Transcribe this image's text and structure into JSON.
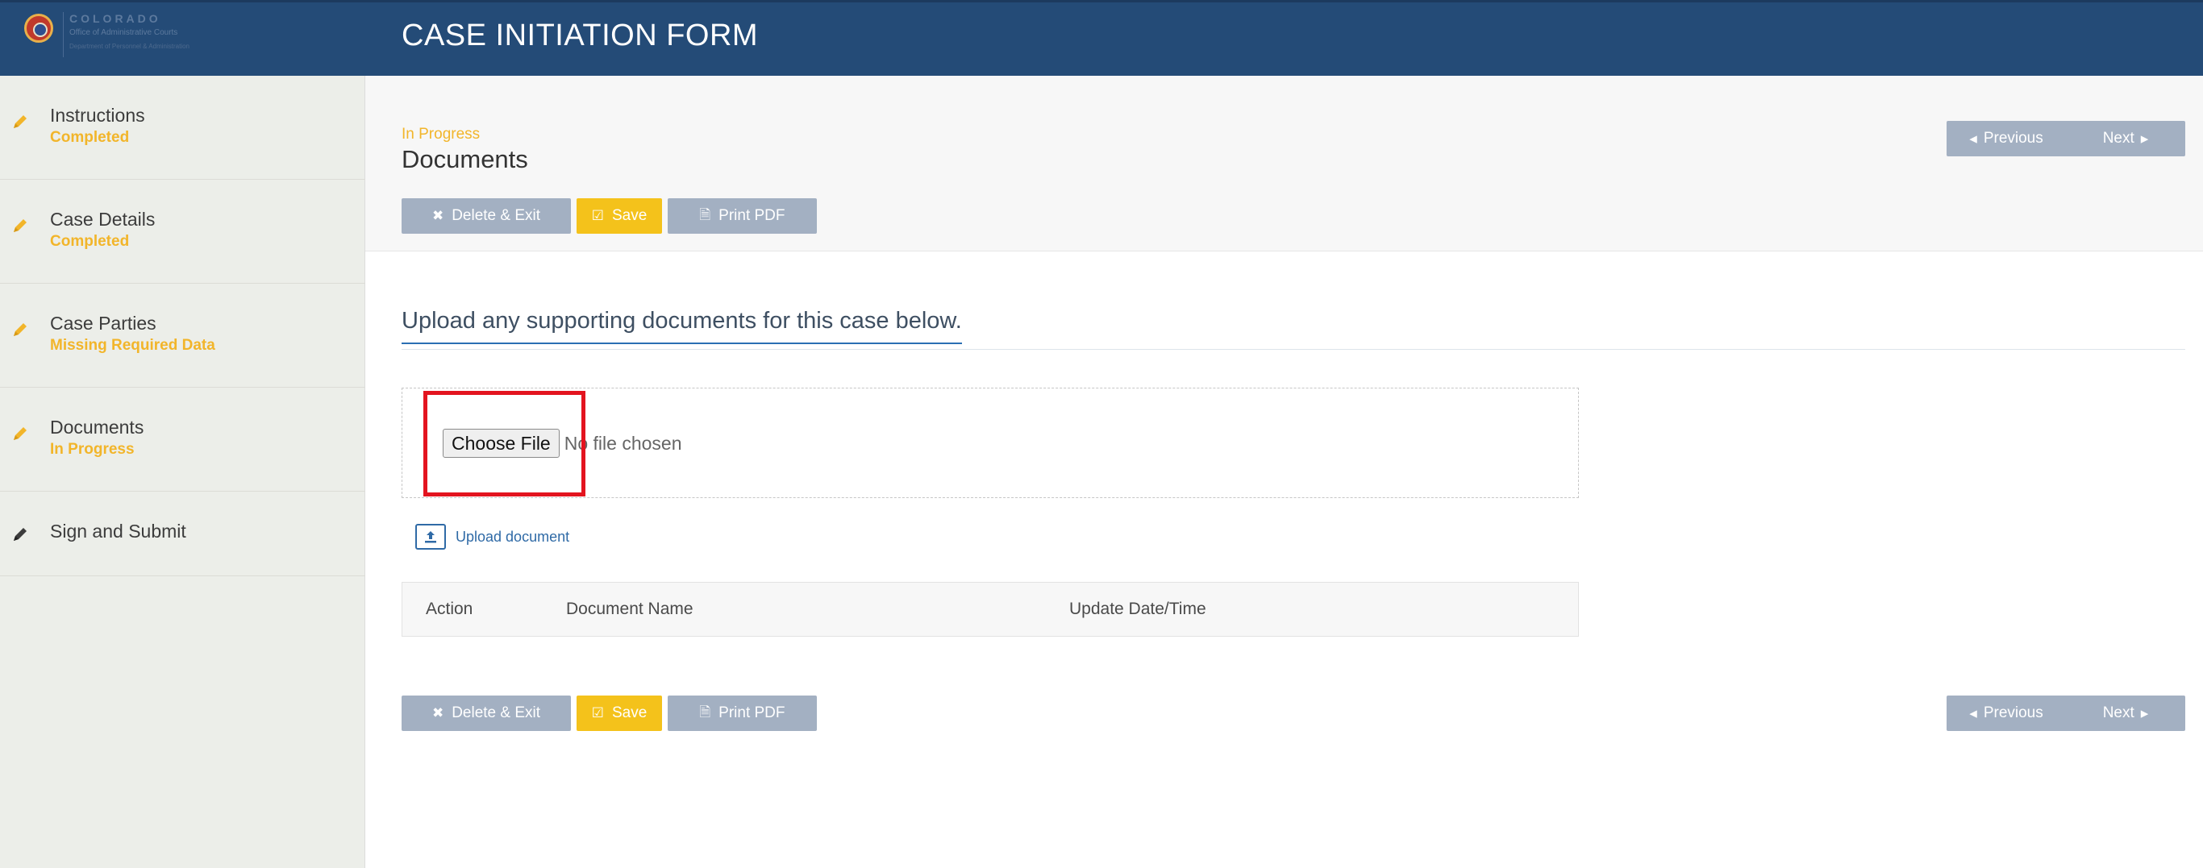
{
  "header": {
    "logo": {
      "line1": "COLORADO",
      "line2": "Office of Administrative Courts",
      "line3": "Department of Personnel & Administration"
    },
    "title": "CASE INITIATION FORM",
    "colors": {
      "header_bg": "#244b77",
      "accent_yellow": "#f4c21b",
      "status_orange": "#f2b52a"
    }
  },
  "sidebar": {
    "items": [
      {
        "label": "Instructions",
        "status": "Completed",
        "icon": "pencil-icon"
      },
      {
        "label": "Case Details",
        "status": "Completed",
        "icon": "pencil-icon"
      },
      {
        "label": "Case Parties",
        "status": "Missing Required Data",
        "icon": "pencil-icon"
      },
      {
        "label": "Documents",
        "status": "In Progress",
        "icon": "pencil-icon"
      },
      {
        "label": "Sign and Submit",
        "status": "",
        "icon": "pencil-icon"
      }
    ]
  },
  "page": {
    "status": "In Progress",
    "title": "Documents"
  },
  "toolbar": {
    "delete_exit": "Delete & Exit",
    "save": "Save",
    "print_pdf": "Print PDF",
    "previous": "Previous",
    "next": "Next"
  },
  "upload": {
    "heading": "Upload any supporting documents for this case below.",
    "choose_file": "Choose File",
    "no_file": "No file chosen",
    "upload_link": "Upload document"
  },
  "documents_table": {
    "columns": [
      "Action",
      "Document Name",
      "Update Date/Time"
    ],
    "rows": []
  }
}
